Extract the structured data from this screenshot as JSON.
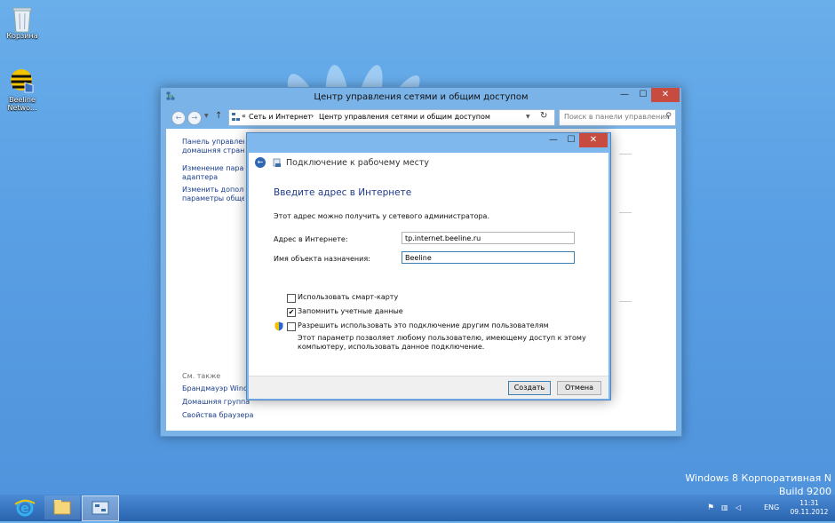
{
  "desktop": {
    "icons": [
      {
        "label": "Корзина"
      },
      {
        "label": "Beeline Netwo..."
      }
    ],
    "watermark": {
      "line1": "Windows 8 Корпоративная N",
      "line2": "Build 9200"
    }
  },
  "window": {
    "title": "Центр управления сетями и общим доступом",
    "address": {
      "root_glyph": "«",
      "crumb1": "Сеть и Интернет",
      "sep": "›",
      "crumb2": "Центр управления сетями и общим доступом"
    },
    "search_placeholder": "Поиск в панели управления",
    "sidebar": {
      "links": [
        "Панель управления –",
        "домашняя страница",
        "Изменение параметров",
        "адаптера",
        "Изменить дополнительные",
        "параметры общего доступа"
      ],
      "see_also": "См. также",
      "see_also_links": [
        "Брандмауэр Windows",
        "Домашняя группа",
        "Свойства браузера"
      ]
    }
  },
  "dialog": {
    "title": "Подключение к рабочему месту",
    "heading": "Введите адрес в Интернете",
    "info": "Этот адрес можно получить у сетевого администратора.",
    "address_label": "Адрес в Интернете:",
    "address_value": "tp.internet.beeline.ru",
    "dest_label": "Имя объекта назначения:",
    "dest_value": "Beeline",
    "checkboxes": [
      {
        "label": "Использовать смарт-карту",
        "checked": false
      },
      {
        "label": "Запомнить учетные данные",
        "checked": true
      },
      {
        "label": "Разрешить использовать это подключение другим пользователям",
        "checked": false
      }
    ],
    "note_line1": "Этот параметр позволяет любому пользователю, имеющему доступ к этому",
    "note_line2": "компьютеру, использовать данное подключение.",
    "create_button": "Создать",
    "cancel_button": "Отмена",
    "check_glyph": "✔"
  },
  "taskbar": {
    "lang": "ENG",
    "time": "11:31",
    "date": "09.11.2012"
  },
  "colors": {
    "desktop": "#5aa0e4",
    "accent_link": "#1a3e8c",
    "close_button": "#c74b3f"
  },
  "icons": [
    "recycle-bin-icon",
    "beeline-icon",
    "network-icon",
    "back-icon",
    "forward-icon",
    "up-icon",
    "refresh-icon",
    "search-icon",
    "shield-icon",
    "ie-icon",
    "explorer-icon",
    "control-panel-icon",
    "flag-icon",
    "network-tray-icon",
    "volume-icon"
  ]
}
